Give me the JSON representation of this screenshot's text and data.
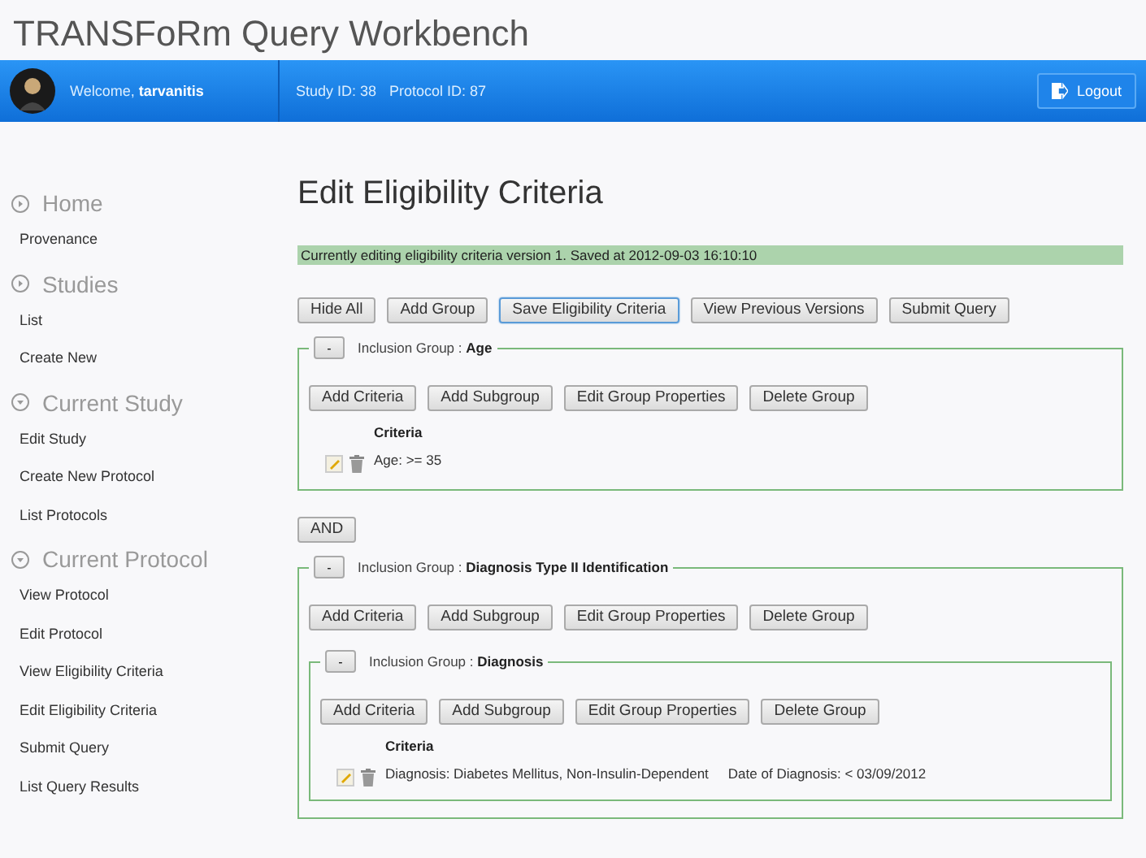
{
  "app_title": "TRANSFoRm Query Workbench",
  "top_bar": {
    "welcome": "Welcome, ",
    "user": "tarvanitis",
    "study": "Study ID: 38",
    "protocol": "Protocol ID: 87",
    "logout": "Logout"
  },
  "sidebar": [
    {
      "heading": "Home",
      "expanded": false,
      "items": [
        "Provenance"
      ]
    },
    {
      "heading": "Studies",
      "expanded": false,
      "items": [
        "List",
        "Create New"
      ]
    },
    {
      "heading": "Current Study",
      "expanded": true,
      "items": [
        "Edit Study",
        "Create New Protocol",
        "List Protocols"
      ]
    },
    {
      "heading": "Current Protocol",
      "expanded": true,
      "items": [
        "View Protocol",
        "Edit Protocol",
        "View Eligibility Criteria",
        "Edit Eligibility Criteria",
        "Submit Query",
        "List Query Results"
      ]
    }
  ],
  "page_title": "Edit Eligibility Criteria",
  "status_message": "Currently editing eligibility criteria version 1. Saved at 2012-09-03 16:10:10",
  "toolbar": [
    {
      "label": "Hide All",
      "focused": false
    },
    {
      "label": "Add Group",
      "focused": false
    },
    {
      "label": "Save Eligibility Criteria",
      "focused": true
    },
    {
      "label": "View Previous Versions",
      "focused": false
    },
    {
      "label": "Submit Query",
      "focused": false
    }
  ],
  "groups": [
    {
      "toggle": "-",
      "type_label": "Inclusion Group : ",
      "name": "Age",
      "buttons": [
        "Add Criteria",
        "Add Subgroup",
        "Edit Group Properties",
        "Delete Group"
      ],
      "criteria_heading": "Criteria",
      "criteria": [
        {
          "parts": [
            "Age: >= 35"
          ]
        }
      ]
    },
    {
      "operator": "AND",
      "toggle": "-",
      "type_label": "Inclusion Group : ",
      "name": "Diagnosis Type II Identification",
      "buttons": [
        "Add Criteria",
        "Add Subgroup",
        "Edit Group Properties",
        "Delete Group"
      ],
      "children": [
        {
          "toggle": "-",
          "type_label": "Inclusion Group : ",
          "name": "Diagnosis",
          "buttons": [
            "Add Criteria",
            "Add Subgroup",
            "Edit Group Properties",
            "Delete Group"
          ],
          "criteria_heading": "Criteria",
          "criteria": [
            {
              "parts": [
                "Diagnosis: Diabetes Mellitus, Non-Insulin-Dependent",
                "Date of Diagnosis: < 03/09/2012"
              ]
            }
          ]
        }
      ]
    }
  ]
}
